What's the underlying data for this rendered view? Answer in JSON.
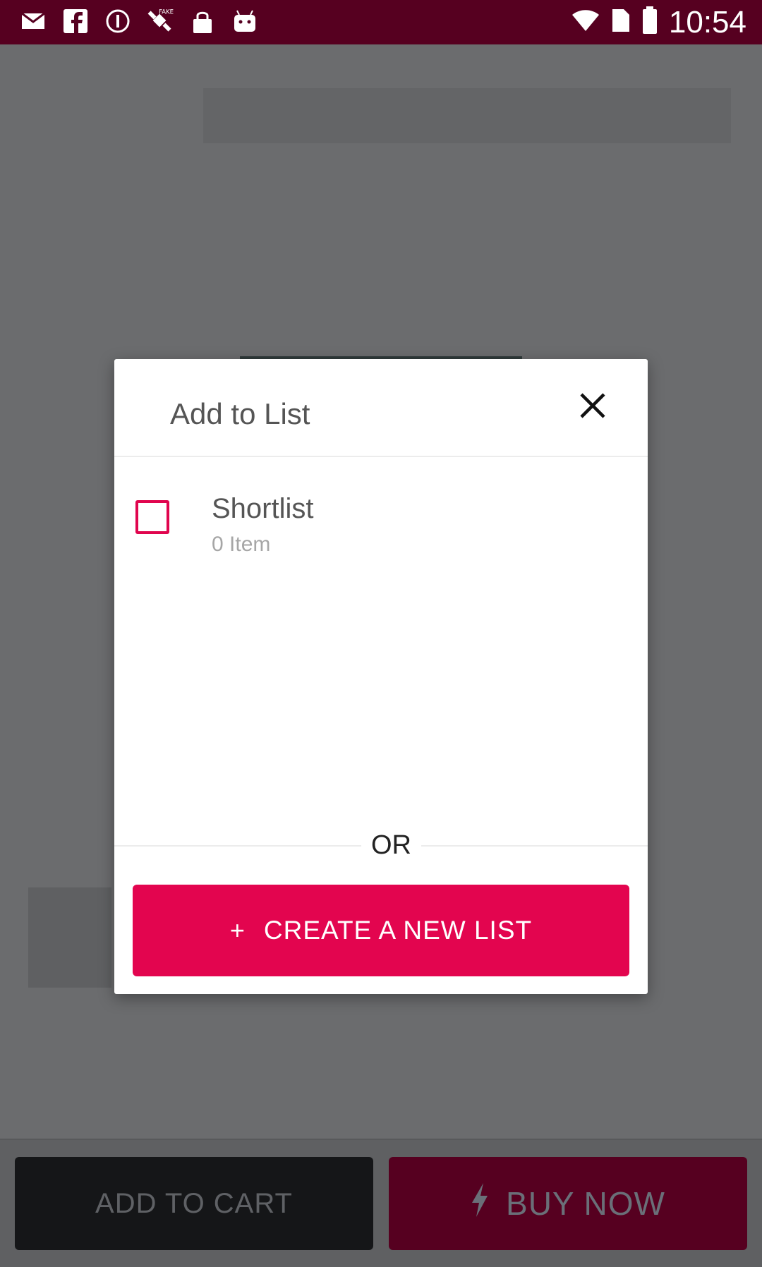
{
  "status_bar": {
    "time": "10:54",
    "icons": [
      "message-icon",
      "facebook-icon",
      "info-icon",
      "fake-gps-icon",
      "lock-icon",
      "android-icon"
    ],
    "right_icons": [
      "wifi-icon",
      "sim-icon",
      "battery-icon"
    ]
  },
  "background": {
    "add_to_cart": "ADD TO CART",
    "buy_now": "BUY NOW"
  },
  "dialog": {
    "title": "Add to List",
    "lists": [
      {
        "name": "Shortlist",
        "count": "0 Item",
        "checked": false
      }
    ],
    "or_label": "OR",
    "create_plus": "+",
    "create_label": "CREATE A NEW LIST"
  },
  "colors": {
    "accent": "#e3054f",
    "status_bar": "#560020",
    "overlay": "#6b6c6e"
  }
}
